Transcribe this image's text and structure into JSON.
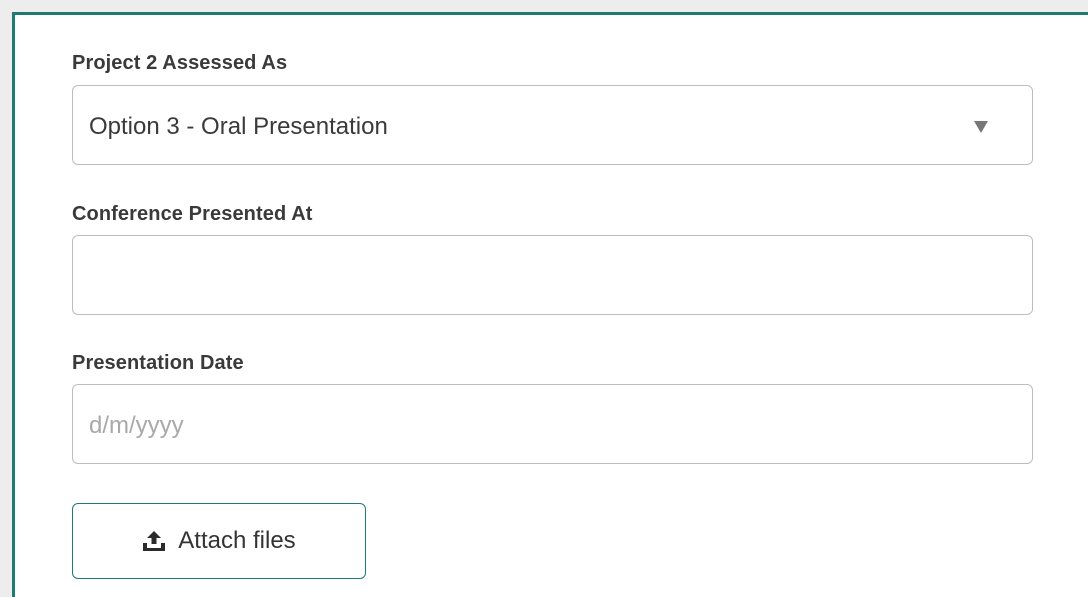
{
  "form": {
    "assessed_label": "Project 2 Assessed As",
    "assessed_value": "Option 3 - Oral Presentation",
    "conference_label": "Conference Presented At",
    "conference_value": "",
    "date_label": "Presentation Date",
    "date_placeholder": "d/m/yyyy",
    "attach_label": "Attach files"
  },
  "icons": {
    "dropdown": "caret-down-icon",
    "attach": "upload-icon"
  },
  "colors": {
    "accent": "#1f7a70",
    "label": "#3a3a3a",
    "border": "#bdbdbd",
    "placeholder": "#a9a9a9"
  }
}
